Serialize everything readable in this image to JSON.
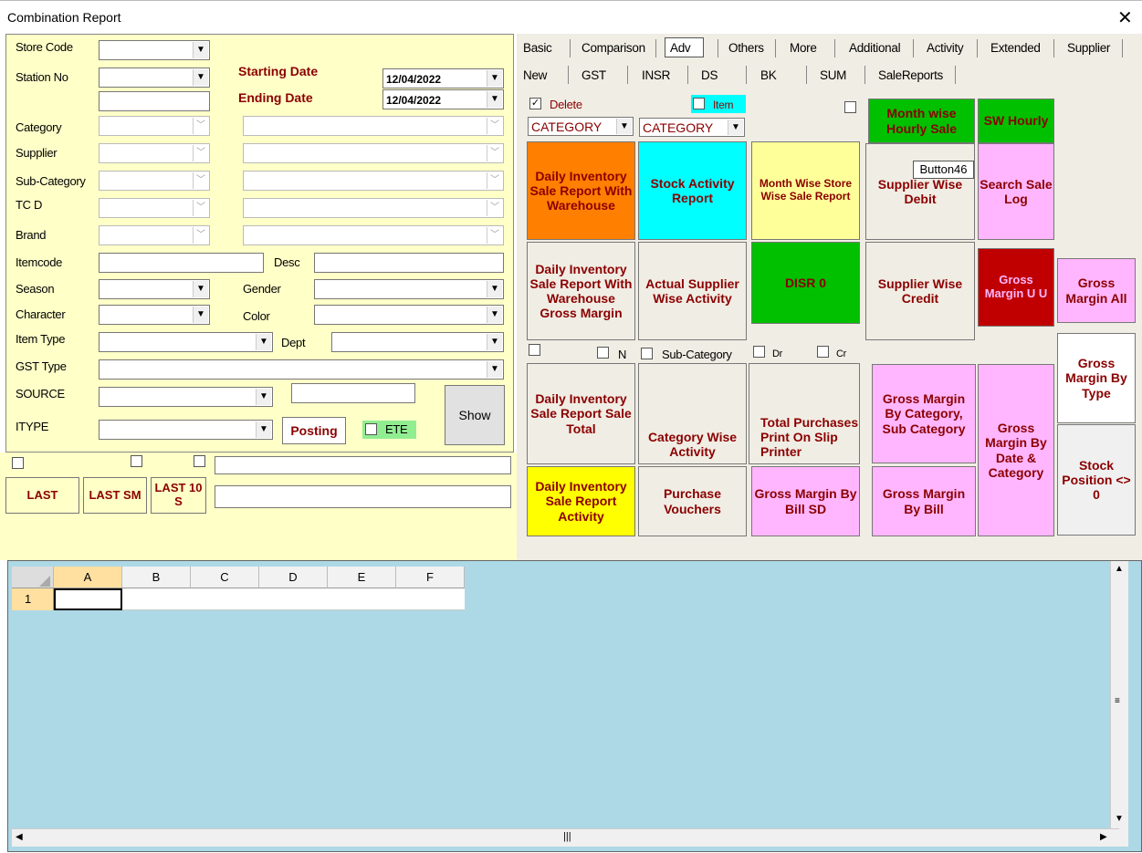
{
  "window": {
    "title": "Combination Report"
  },
  "filters": {
    "store_code": "Store Code",
    "station_no": "Station No",
    "starting_date": "Starting Date",
    "ending_date": "Ending Date",
    "start_date_value": "12/04/2022",
    "end_date_value": "12/04/2022",
    "category": "Category",
    "supplier": "Supplier",
    "sub_category": "Sub-Category",
    "tc_d": "TC D",
    "brand": "Brand",
    "itemcode": "Itemcode",
    "desc": "Desc",
    "season": "Season",
    "gender": "Gender",
    "character": "Character",
    "color": "Color",
    "item_type": "Item Type",
    "dept": "Dept",
    "gst_type": "GST Type",
    "source": "SOURCE",
    "itype": "ITYPE",
    "posting": "Posting",
    "ete": "ETE",
    "show": "Show"
  },
  "last_buttons": {
    "last": "LAST",
    "last_sm": "LAST SM",
    "last_10s": "LAST 10 S"
  },
  "tabs_row1": [
    "Basic",
    "Comparison",
    "Adv",
    "Others",
    "More",
    "Additional",
    "Activity",
    "Extended",
    "Supplier"
  ],
  "tabs_row2": [
    "New",
    "GST",
    "INSR",
    "DS",
    "BK",
    "SUM",
    "SaleReports"
  ],
  "options": {
    "delete": "Delete",
    "item": "Item",
    "category1": "CATEGORY",
    "category2": "CATEGORY",
    "n": "N",
    "sub_category": "Sub-Category",
    "dr": "Dr",
    "cr": "Cr",
    "tooltip": "Button46"
  },
  "buttons": {
    "month_wise_hourly": "Month wise Hourly Sale",
    "sw_hourly": "SW Hourly",
    "daily_inv_wh": "Daily Inventory Sale Report With Warehouse",
    "stock_activity": "Stock Activity Report",
    "month_wise_store": "Month Wise Store Wise Sale Report",
    "supplier_debit": "Supplier Wise Debit",
    "search_sale_log": "Search Sale Log",
    "daily_inv_wh_gm": "Daily Inventory Sale Report With Warehouse Gross Margin",
    "actual_supplier": "Actual Supplier Wise Activity",
    "disr0": "DISR 0",
    "supplier_credit": "Supplier Wise Credit",
    "gm_uu": "Gross Margin U U",
    "gm_all": "Gross Margin All",
    "gm_by_type": "Gross Margin By Type",
    "daily_inv_total": "Daily Inventory Sale Report Sale Total",
    "category_activity": "Category Wise Activity",
    "total_purchases": "Total Purchases Print On Slip Printer",
    "gm_cat_sub": "Gross Margin By Category, Sub Category",
    "gm_date_cat": "Gross Margin By Date & Category",
    "stock_position": "Stock Position <> 0",
    "daily_inv_activity": "Daily Inventory Sale Report Activity",
    "purchase_vouchers": "Purchase Vouchers",
    "gm_bill_sd": "Gross Margin By Bill SD",
    "gm_bill": "Gross Margin By Bill"
  },
  "grid": {
    "columns": [
      "A",
      "B",
      "C",
      "D",
      "E",
      "F"
    ],
    "row": "1"
  },
  "colors": {
    "orange": "#ff7f00",
    "cyan": "#00ffff",
    "yellow": "#ffff00",
    "lightyellow": "#ffff99",
    "green": "#00c000",
    "pink": "#ffb6ff",
    "darkred": "#c00000",
    "beige": "#f0ede4"
  }
}
